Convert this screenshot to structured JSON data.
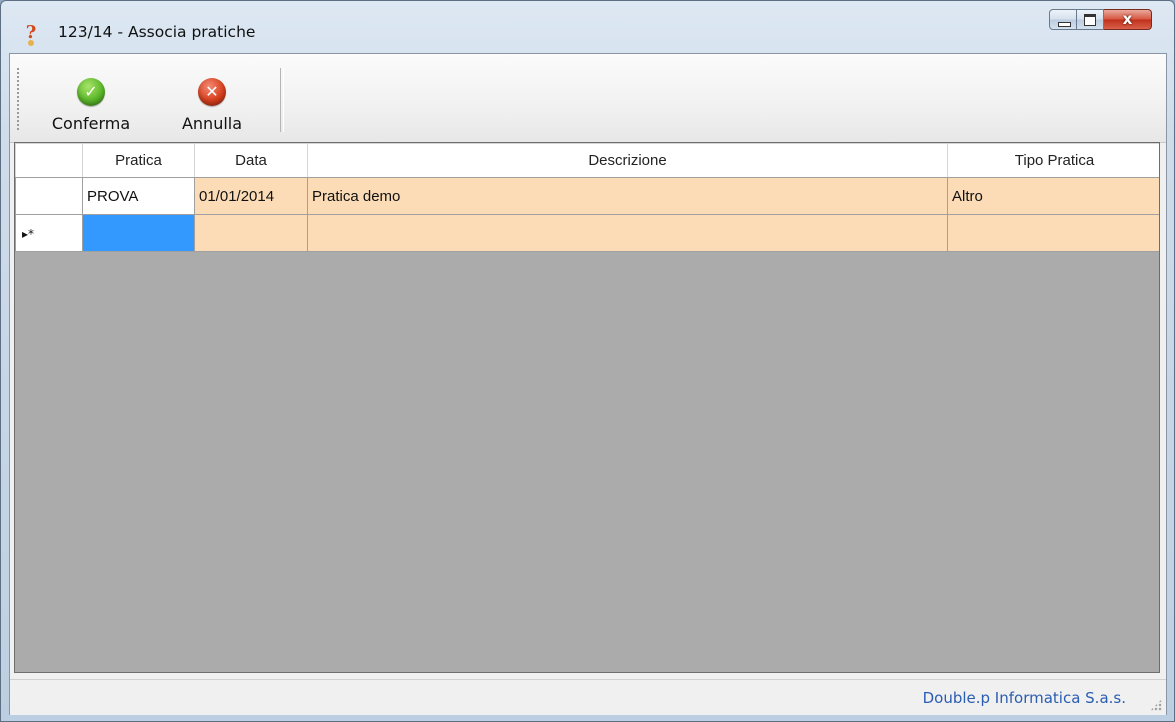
{
  "window": {
    "title": "123/14 - Associa pratiche",
    "close_glyph": "x"
  },
  "toolbar": {
    "confirm_label": "Conferma",
    "confirm_icon": "check-circle-icon",
    "confirm_glyph": "✓",
    "cancel_label": "Annulla",
    "cancel_icon": "x-circle-icon",
    "cancel_glyph": "✕"
  },
  "grid": {
    "columns": [
      "Pratica",
      "Data",
      "Descrizione",
      "Tipo Pratica"
    ],
    "rows": [
      {
        "pratica": "PROVA",
        "data": "01/01/2014",
        "descrizione": "Pratica demo",
        "tipo": "Altro"
      }
    ],
    "new_row_marker": "▸*",
    "row_color": "#fcdcb6",
    "selected_cell_color": "#3399ff"
  },
  "status": {
    "company": "Double.p Informatica S.a.s."
  }
}
